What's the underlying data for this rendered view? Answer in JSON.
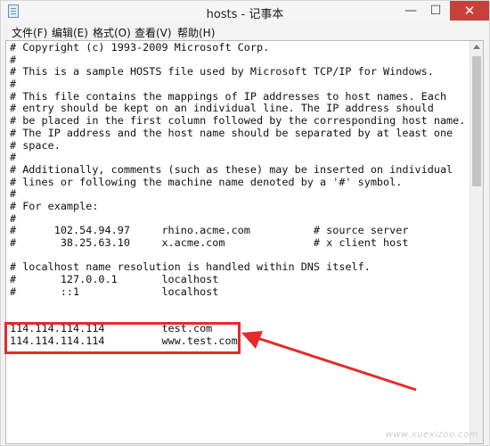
{
  "window": {
    "title": "hosts - 记事本",
    "controls": {
      "minimize": "—",
      "maximize": "☐",
      "close": "✕"
    }
  },
  "menu": {
    "items": [
      {
        "label": "文件(F)"
      },
      {
        "label": "编辑(E)"
      },
      {
        "label": "格式(O)"
      },
      {
        "label": "查看(V)"
      },
      {
        "label": "帮助(H)"
      }
    ]
  },
  "editor": {
    "lines": [
      "# Copyright (c) 1993-2009 Microsoft Corp.",
      "#",
      "# This is a sample HOSTS file used by Microsoft TCP/IP for Windows.",
      "#",
      "# This file contains the mappings of IP addresses to host names. Each",
      "# entry should be kept on an individual line. The IP address should",
      "# be placed in the first column followed by the corresponding host name.",
      "# The IP address and the host name should be separated by at least one",
      "# space.",
      "#",
      "# Additionally, comments (such as these) may be inserted on individual",
      "# lines or following the machine name denoted by a '#' symbol.",
      "#",
      "# For example:",
      "#",
      "#      102.54.94.97     rhino.acme.com          # source server",
      "#       38.25.63.10     x.acme.com              # x client host",
      "",
      "# localhost name resolution is handled within DNS itself.",
      "#       127.0.0.1       localhost",
      "#       ::1             localhost",
      "",
      "",
      "114.114.114.114         test.com",
      "114.114.114.114         www.test.com"
    ]
  },
  "annotation": {
    "color": "#e52b2b"
  },
  "watermark": "www.xuexizoo.com"
}
